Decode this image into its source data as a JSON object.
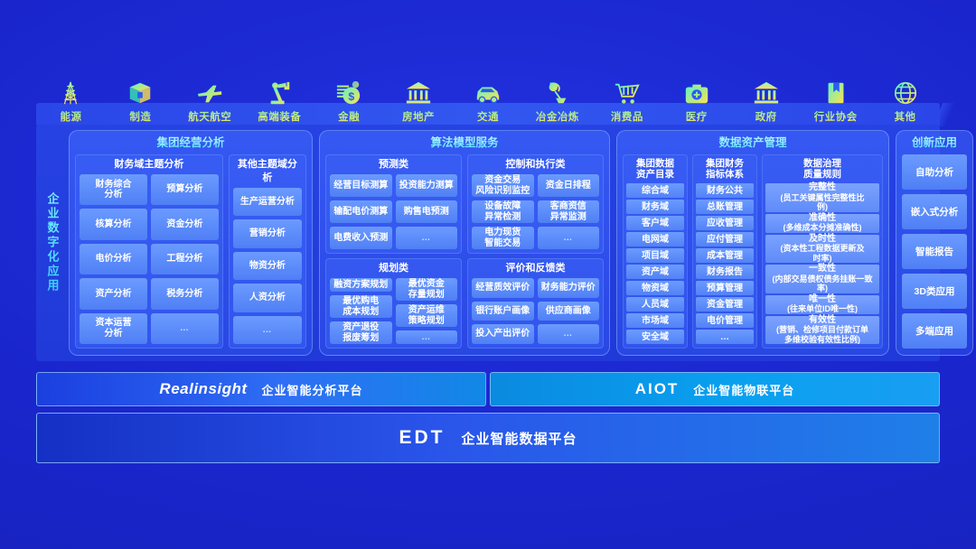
{
  "industries": [
    {
      "label": "能源",
      "icon": "power-tower-icon"
    },
    {
      "label": "制造",
      "icon": "box-icon"
    },
    {
      "label": "航天航空",
      "icon": "airplane-icon"
    },
    {
      "label": "高端装备",
      "icon": "robot-arm-icon"
    },
    {
      "label": "金融",
      "icon": "money-coin-icon"
    },
    {
      "label": "房地产",
      "icon": "bank-building-icon"
    },
    {
      "label": "交通",
      "icon": "car-icon"
    },
    {
      "label": "冶金冶炼",
      "icon": "smelting-ladle-icon"
    },
    {
      "label": "消费品",
      "icon": "shopping-cart-icon"
    },
    {
      "label": "医疗",
      "icon": "medical-kit-icon"
    },
    {
      "label": "政府",
      "icon": "government-building-icon"
    },
    {
      "label": "行业协会",
      "icon": "book-icon"
    },
    {
      "label": "其他",
      "icon": "globe-icon"
    }
  ],
  "side_label": "企业数字化应用",
  "panels": {
    "group_operation": {
      "title": "集团经营分析",
      "groups": [
        {
          "title": "财务域主题分析",
          "columns": [
            [
              "财务综合\n分析",
              "核算分析",
              "电价分析",
              "资产分析",
              "资本运营\n分析"
            ],
            [
              "预算分析",
              "资金分析",
              "工程分析",
              "税务分析",
              "…"
            ]
          ]
        },
        {
          "title": "其他主题域分析",
          "columns": [
            [
              "生产运营分析",
              "营销分析",
              "物资分析",
              "人资分析",
              "…"
            ]
          ]
        }
      ]
    },
    "algorithm_model": {
      "title": "算法模型服务",
      "rows": [
        [
          {
            "title": "预测类",
            "columns": [
              [
                "经营目标测算",
                "输配电价测算",
                "电费收入预测"
              ],
              [
                "投资能力测算",
                "购售电预测",
                "…"
              ]
            ]
          },
          {
            "title": "控制和执行类",
            "columns": [
              [
                "资金交易\n风险识别监控",
                "设备故障\n异常检测",
                "电力现货\n智能交易"
              ],
              [
                "资金日排程",
                "客商资信\n异常监测",
                "…"
              ]
            ]
          }
        ],
        [
          {
            "title": "规划类",
            "columns": [
              [
                "融资方案规划",
                "最优购电\n成本规划",
                "资产退役\n报废筹划"
              ],
              [
                "最优资金\n存量规划",
                "资产运维\n策略规划",
                "…"
              ]
            ]
          },
          {
            "title": "评价和反馈类",
            "columns": [
              [
                "经营质效评价",
                "银行账户画像",
                "投入产出评价"
              ],
              [
                "财务能力评价",
                "供应商画像",
                "…"
              ]
            ]
          }
        ]
      ]
    },
    "data_asset": {
      "title": "数据资产管理",
      "catalog": {
        "title": "集团数据\n资产目录",
        "items": [
          "综合域",
          "财务域",
          "客户域",
          "电网域",
          "项目域",
          "资产域",
          "物资域",
          "人员域",
          "市场域",
          "安全域"
        ]
      },
      "indicator": {
        "title": "集团财务\n指标体系",
        "items": [
          "财务公共",
          "总账管理",
          "应收管理",
          "应付管理",
          "成本管理",
          "财务报告",
          "预算管理",
          "资金管理",
          "电价管理",
          "…"
        ]
      },
      "governance": {
        "title": "数据治理\n质量规则",
        "items": [
          {
            "name": "完整性",
            "desc": "(员工关键属性完整性比\n例)"
          },
          {
            "name": "准确性",
            "desc": "(多维成本分摊准确性)"
          },
          {
            "name": "及时性",
            "desc": "(资本性工程数据更新及\n时率)"
          },
          {
            "name": "一致性",
            "desc": "(内部交易债权债务挂账一致\n率)"
          },
          {
            "name": "唯一性",
            "desc": "(往来单位ID唯一性)"
          },
          {
            "name": "有效性",
            "desc": "(营销、检修项目付款订单\n多维校验有效性比例)"
          }
        ]
      }
    },
    "innovation": {
      "title": "创新应用",
      "items": [
        "自助分析",
        "嵌入式分析",
        "智能报告",
        "3D类应用",
        "多端应用"
      ]
    }
  },
  "platforms": [
    {
      "logo": "Realinsight",
      "name": "企业智能分析平台"
    },
    {
      "logo": "AIOT",
      "name": "企业智能物联平台"
    }
  ],
  "base_platform": {
    "logo": "EDT",
    "name": "企业智能数据平台"
  },
  "colors": {
    "background": "#1b27cf",
    "panel": "#3a60f5",
    "cell": "#5f8bf8",
    "accent_cyan": "#4fe0ff",
    "accent_yellow": "#ffe14d",
    "accent_green": "#8df6b0"
  }
}
